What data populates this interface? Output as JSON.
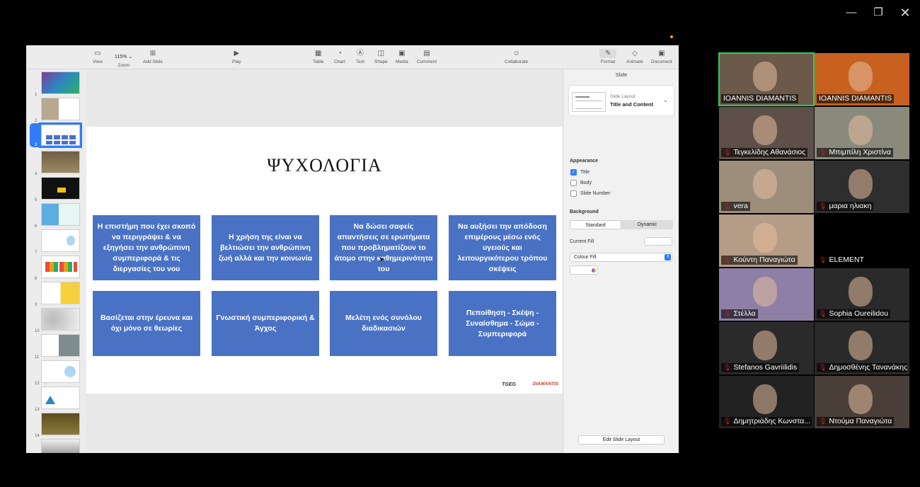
{
  "window_controls": {
    "minimize": "—",
    "maximize": "❐",
    "close": "✕"
  },
  "toolbar": {
    "view": "View",
    "zoom_value": "115% ⌄",
    "zoom": "Zoom",
    "add_slide": "Add Slide",
    "play": "Play",
    "table": "Table",
    "chart": "Chart",
    "text": "Text",
    "shape": "Shape",
    "media": "Media",
    "comment": "Comment",
    "collaborate": "Collaborate",
    "format": "Format",
    "animate": "Animate",
    "document": "Document"
  },
  "navigator": {
    "selected": 3,
    "slides": [
      "1",
      "2",
      "3",
      "4",
      "5",
      "6",
      "7",
      "8",
      "9",
      "10",
      "11",
      "12",
      "13",
      "14"
    ]
  },
  "slide": {
    "title": "ΨΥΧΟΛΟΓΙΑ",
    "boxes": [
      "Η επιστήμη που έχει σκοπό να περιγράψει & να εξηγήσει την ανθρώπινη συμπεριφορά & τις διεργασίες του νου",
      "Η χρήση της είναι να βελτιώσει την ανθρώπινη ζωή αλλά και την κοινωνία",
      "Να δώσει σαφείς απαντήσεις σε ερωτήματα που προβληματίζουν το άτομο στην καθημερινότητα του",
      "Να αυξήσει την απόδοση επιμέρους μέσω ενός υγειούς και λειτουργικότερου τρόπου σκέψεις",
      "Βασίζεται στην έρευνα και όχι μόνο σε θεωρίες",
      "Γνωστική συμπεριφορική & Άγχος",
      "Μελέτη ενός συνόλου διαδικασιών",
      "Πεποίθηση - Σκέψη - Συναίσθημα - Σώμα - Συμπεριφορά"
    ],
    "logo_left": "TGEG",
    "logo_right": "DIAMANTIS",
    "box_color": "#4a72c4"
  },
  "inspector": {
    "tab": "Slide",
    "layout_caption": "Slide Layout",
    "layout_name": "Title and Content",
    "appearance": "Appearance",
    "checks": [
      {
        "label": "Title",
        "checked": true
      },
      {
        "label": "Body",
        "checked": false
      },
      {
        "label": "Slide Number",
        "checked": false
      }
    ],
    "background": "Background",
    "seg_standard": "Standard",
    "seg_dynamic": "Dynamic",
    "current_fill": "Current Fill",
    "fill_type": "Colour Fill",
    "edit_layout": "Edit Slide Layout"
  },
  "participants": [
    {
      "name": "IOANNIS DIAMANTIS",
      "muted": false,
      "active": true,
      "bg": "#6b5a4a"
    },
    {
      "name": "IOANNIS DIAMANTIS",
      "muted": false,
      "active": false,
      "bg": "#c8611f"
    },
    {
      "name": "Τεγκελίδης Αθανάσιος",
      "muted": true,
      "active": false,
      "bg": "#5e5048"
    },
    {
      "name": "Μπιμπίλη Χριστίνα",
      "muted": true,
      "active": false,
      "bg": "#8a8a7c"
    },
    {
      "name": "vera",
      "muted": true,
      "active": false,
      "bg": "#9c8e7a"
    },
    {
      "name": "μαρια ηλιακη",
      "muted": true,
      "active": false,
      "bg": "#2e2e2e"
    },
    {
      "name": "Κούντη Παναγιώτα",
      "muted": true,
      "active": false,
      "bg": "#b49c86"
    },
    {
      "name": "ELEMENT",
      "muted": true,
      "active": false,
      "bg": "#000000"
    },
    {
      "name": "Στέλλα",
      "muted": true,
      "active": false,
      "bg": "#8e7fa6"
    },
    {
      "name": "Sophia Oureilidou",
      "muted": true,
      "active": false,
      "bg": "#2a2a2a"
    },
    {
      "name": "Stefanos Gavriilidis",
      "muted": true,
      "active": false,
      "bg": "#2a2a2a"
    },
    {
      "name": "Δημοσθένης Τανανάκης",
      "muted": true,
      "active": false,
      "bg": "#2a2a2a"
    },
    {
      "name": "Δημητριάδης Κωνστα...",
      "muted": true,
      "active": false,
      "bg": "#222222"
    },
    {
      "name": "Ντούμα Παναγιώτα",
      "muted": true,
      "active": false,
      "bg": "#4a3f38"
    }
  ]
}
